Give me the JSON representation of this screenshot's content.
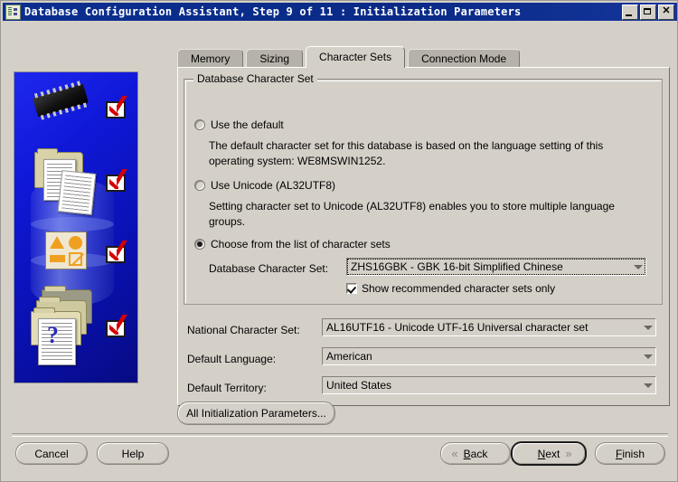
{
  "window": {
    "title": "Database Configuration Assistant, Step 9 of 11 : Initialization Parameters",
    "icon": "database-assistant-icon",
    "minimize_label": "Minimize",
    "maximize_label": "Maximize",
    "close_label": "✕",
    "titlebar_color": "#0a2a86"
  },
  "tabs": [
    {
      "label": "Memory",
      "active": false
    },
    {
      "label": "Sizing",
      "active": false
    },
    {
      "label": "Character Sets",
      "active": true
    },
    {
      "label": "Connection Mode",
      "active": false
    }
  ],
  "character_sets": {
    "group_title": "Database Character Set",
    "options": [
      {
        "label": "Use the default",
        "selected": false,
        "description": "The default character set for this database is based on the language setting of this operating system: WE8MSWIN1252."
      },
      {
        "label": "Use Unicode (AL32UTF8)",
        "selected": false,
        "description": "Setting character set to Unicode (AL32UTF8) enables you to store multiple language groups."
      },
      {
        "label": "Choose from the list of character sets",
        "selected": true,
        "description": ""
      }
    ],
    "db_charset_label": "Database Character Set:",
    "db_charset_value": "ZHS16GBK - GBK 16-bit Simplified Chinese",
    "show_recommended_label": "Show recommended character sets only",
    "show_recommended_checked": true
  },
  "fields": [
    {
      "label": "National Character Set:",
      "value": "AL16UTF16 - Unicode UTF-16 Universal character set"
    },
    {
      "label": "Default Language:",
      "value": "American"
    },
    {
      "label": "Default Territory:",
      "value": "United States"
    }
  ],
  "all_params_button": "All Initialization Parameters...",
  "footer": {
    "cancel": "Cancel",
    "help": "Help",
    "back": "Back",
    "next": "Next",
    "finish": "Finish",
    "back_chevron": "«",
    "next_chevron": "»"
  },
  "sidepanel": {
    "background_color": "#1018d8",
    "icons": [
      "memory-chip-icon",
      "documents-folder-icon",
      "shapes-icon",
      "help-documents-icon"
    ],
    "check_count": 4
  }
}
